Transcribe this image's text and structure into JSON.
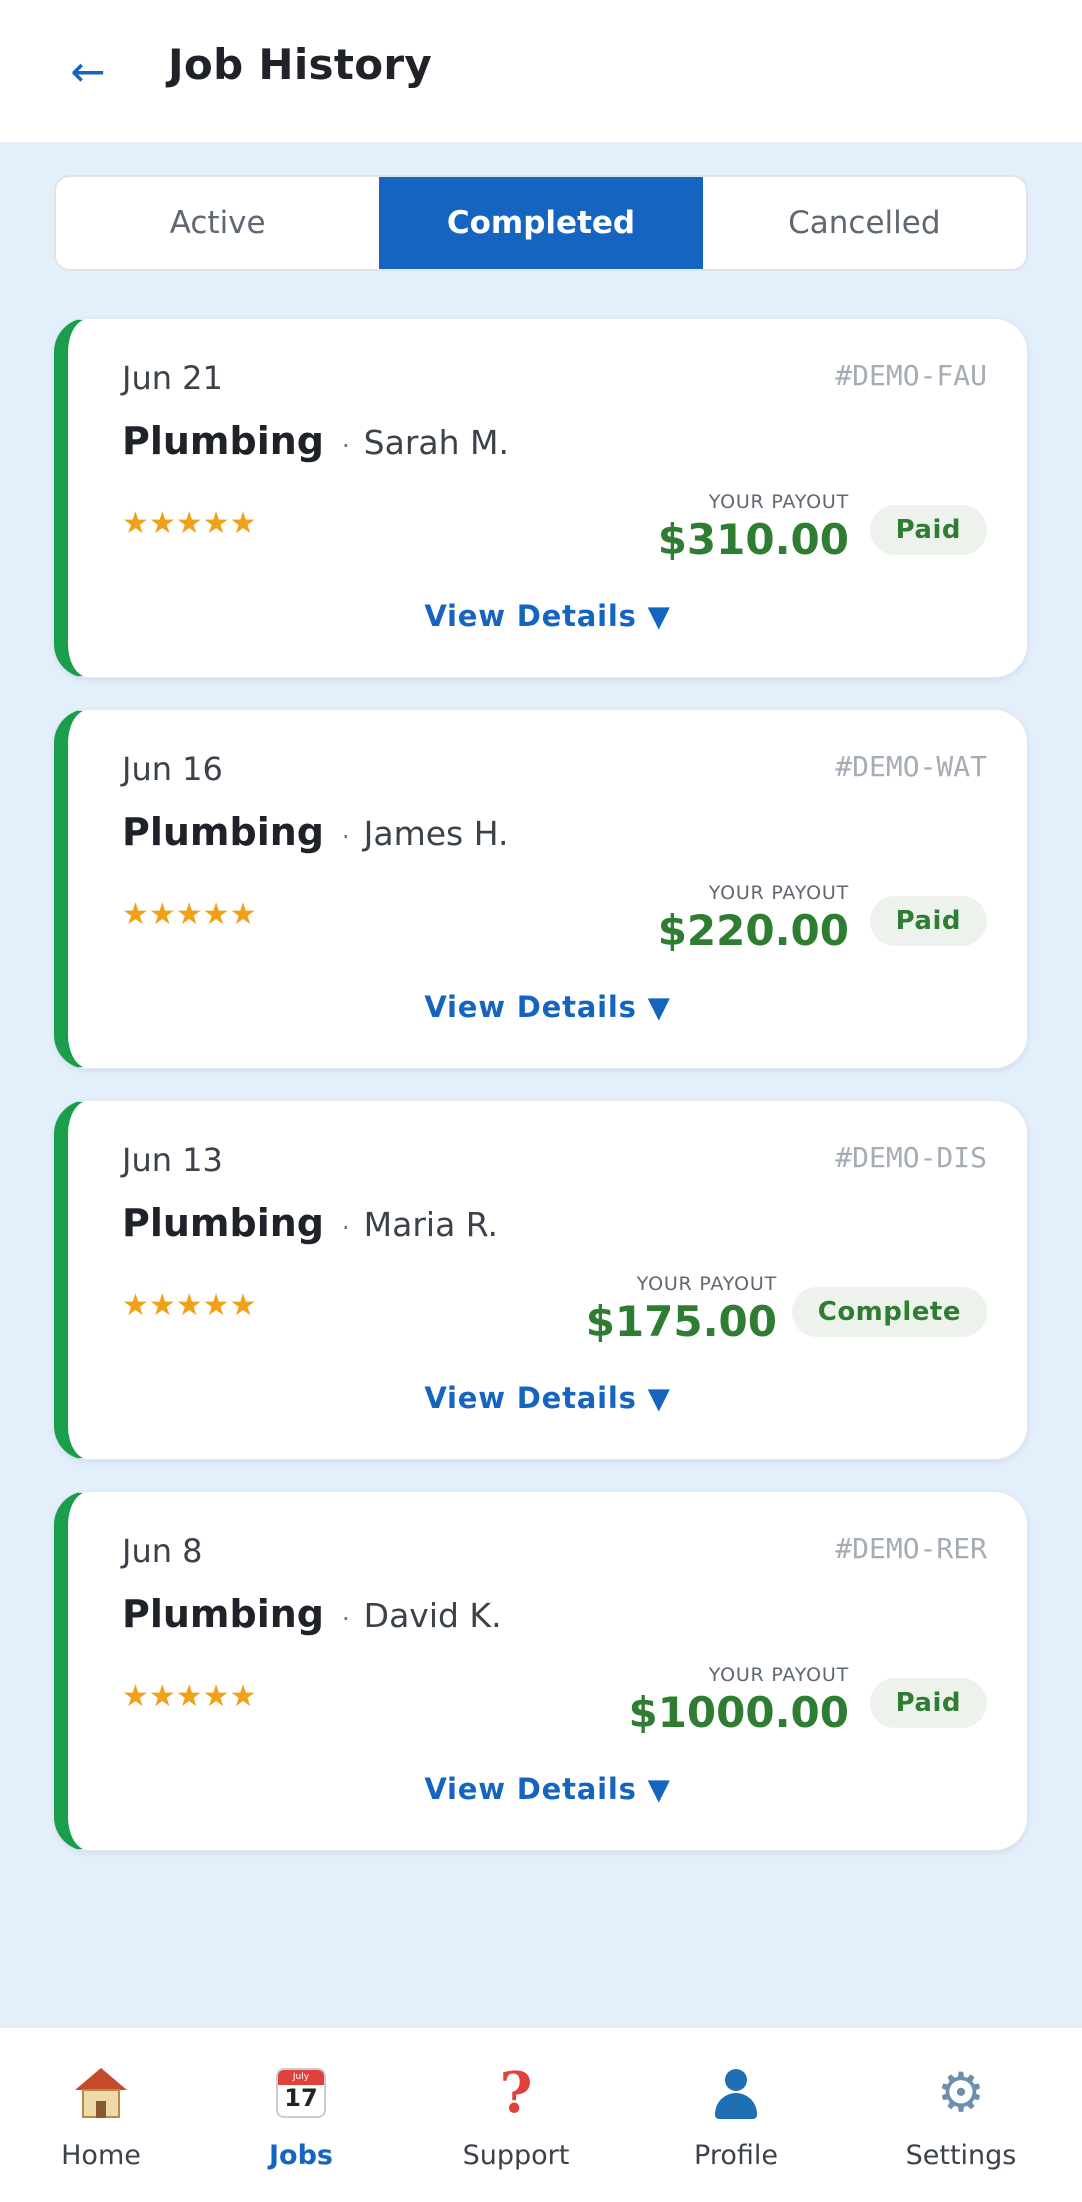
{
  "header": {
    "back_icon": "arrow-left-icon",
    "back_glyph": "←",
    "title": "Job History"
  },
  "tabs": [
    {
      "label": "Active",
      "active": false
    },
    {
      "label": "Completed",
      "active": true
    },
    {
      "label": "Cancelled",
      "active": false
    }
  ],
  "colors": {
    "accent": "#1565c0",
    "card_stripe": "#1a9e4b",
    "payout": "#2e7d32",
    "star": "#f0a019",
    "background": "#e3effb"
  },
  "jobs": [
    {
      "date": "Jun 21",
      "ref": "#DEMO-FAU",
      "service": "Plumbing",
      "separator": "·",
      "customer": "Sarah M.",
      "rating": 5,
      "stars": "★★★★★",
      "payout_label": "YOUR PAYOUT",
      "payout": "$310.00",
      "status": "Paid",
      "details_label": "View Details ▼"
    },
    {
      "date": "Jun 16",
      "ref": "#DEMO-WAT",
      "service": "Plumbing",
      "separator": "·",
      "customer": "James H.",
      "rating": 5,
      "stars": "★★★★★",
      "payout_label": "YOUR PAYOUT",
      "payout": "$220.00",
      "status": "Paid",
      "details_label": "View Details ▼"
    },
    {
      "date": "Jun 13",
      "ref": "#DEMO-DIS",
      "service": "Plumbing",
      "separator": "·",
      "customer": "Maria R.",
      "rating": 5,
      "stars": "★★★★★",
      "payout_label": "YOUR PAYOUT",
      "payout": "$175.00",
      "status": "Complete",
      "details_label": "View Details ▼"
    },
    {
      "date": "Jun 8",
      "ref": "#DEMO-RER",
      "service": "Plumbing",
      "separator": "·",
      "customer": "David K.",
      "rating": 5,
      "stars": "★★★★★",
      "payout_label": "YOUR PAYOUT",
      "payout": "$1000.00",
      "status": "Paid",
      "details_label": "View Details ▼"
    }
  ],
  "bottom_nav": [
    {
      "label": "Home",
      "icon": "house-icon",
      "active": false
    },
    {
      "label": "Jobs",
      "icon": "calendar-icon",
      "calendar_month": "July",
      "calendar_day": "17",
      "active": true
    },
    {
      "label": "Support",
      "icon": "question-mark-icon",
      "glyph": "?",
      "active": false
    },
    {
      "label": "Profile",
      "icon": "person-icon",
      "active": false
    },
    {
      "label": "Settings",
      "icon": "gear-icon",
      "glyph": "⚙",
      "active": false
    }
  ]
}
